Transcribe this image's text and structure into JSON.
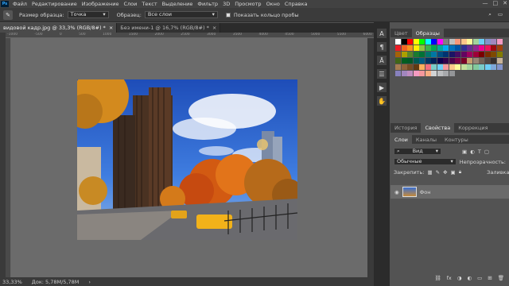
{
  "menubar": {
    "logo": "Ps",
    "items": [
      "Файл",
      "Редактирование",
      "Изображение",
      "Слои",
      "Текст",
      "Выделение",
      "Фильтр",
      "3D",
      "Просмотр",
      "Окно",
      "Справка"
    ],
    "window_controls": [
      "—",
      "□",
      "✕"
    ]
  },
  "options": {
    "sample_size_label": "Размер образца:",
    "sample_size_value": "Точка",
    "sample_label": "Образец:",
    "sample_value": "Все слои",
    "show_ring_label": "Показать кольцо пробы"
  },
  "tabs": [
    {
      "label": "видовой кадр.jpg @ 33,3% (RGB/8#) *",
      "close": "×"
    },
    {
      "label": "Без имени-1 @ 16,7% (RGB/8#) *",
      "close": "×"
    }
  ],
  "ruler_ticks": [
    "-1000",
    "-500",
    "0",
    "500",
    "1000",
    "1500",
    "2000",
    "2500",
    "3000",
    "3500",
    "4000",
    "4500",
    "5000",
    "5500",
    "6000"
  ],
  "status": {
    "zoom": "33,33%",
    "doc": "Док: 5,78M/5,78M"
  },
  "side_tool_icons": [
    "character-icon",
    "paragraph-icon",
    "text-tool-icon",
    "adjust-icon",
    "play-icon",
    "hand-icon"
  ],
  "swatches_panel": {
    "tabs": [
      "Цвет",
      "Образцы"
    ],
    "colors": [
      "#ffffff",
      "#000000",
      "#ff0000",
      "#ffff00",
      "#00ff00",
      "#00ffff",
      "#0000ff",
      "#ff00ff",
      "#808080",
      "#c0c0c0",
      "#f7977a",
      "#fdc68a",
      "#fff79a",
      "#a4d39b",
      "#6dcff6",
      "#8493ca",
      "#a187be",
      "#f49ac2",
      "#ed1c24",
      "#f26522",
      "#f7941d",
      "#fff200",
      "#8dc63f",
      "#39b54a",
      "#00a651",
      "#00a99d",
      "#00aeef",
      "#0072bc",
      "#0054a6",
      "#2e3192",
      "#662d91",
      "#92278f",
      "#ec008c",
      "#ed145b",
      "#9e0b0f",
      "#a0410d",
      "#a36209",
      "#aba000",
      "#598527",
      "#1a7b30",
      "#007236",
      "#00746b",
      "#0076a3",
      "#004b80",
      "#003471",
      "#1b1464",
      "#440e62",
      "#630460",
      "#9e005d",
      "#9e0039",
      "#790000",
      "#7b2e00",
      "#7d4900",
      "#827b00",
      "#406618",
      "#005e20",
      "#005826",
      "#005952",
      "#005b7f",
      "#003663",
      "#002157",
      "#0d004c",
      "#32004b",
      "#4b0049",
      "#7b0046",
      "#7a0026",
      "#c69c6d",
      "#998675",
      "#736357",
      "#534741",
      "#362f2d",
      "#c7b299",
      "#a67c52",
      "#8c6239",
      "#754c24",
      "#603913",
      "#fbaf5d",
      "#f26d7d",
      "#7accc8",
      "#6ecff6",
      "#f5989d",
      "#fdc689",
      "#fff799",
      "#c4df9b",
      "#a3d39c",
      "#82ca9c",
      "#7accc8",
      "#6dcff6",
      "#7ea7d8",
      "#8393ca",
      "#8781bd",
      "#a186be",
      "#bd8cbf",
      "#f49ac1",
      "#f5989d",
      "#f9ad81",
      "#d1d3d4",
      "#bcbec0",
      "#a7a9ac",
      "#939598"
    ]
  },
  "properties_panel": {
    "tabs": [
      "История",
      "Свойства",
      "Коррекция"
    ]
  },
  "layers_panel": {
    "tabs": [
      "Слои",
      "Каналы",
      "Контуры"
    ],
    "filter_value": "Вид",
    "blend_mode": "Обычные",
    "opacity_label": "Непрозрачность:",
    "lock_label": "Закрепить:",
    "fill_label": "Заливка:",
    "layer_name": "Фон",
    "footer_icons": [
      "link-icon",
      "fx-icon",
      "mask-icon",
      "adjustment-icon",
      "group-icon",
      "new-layer-icon",
      "trash-icon"
    ]
  }
}
